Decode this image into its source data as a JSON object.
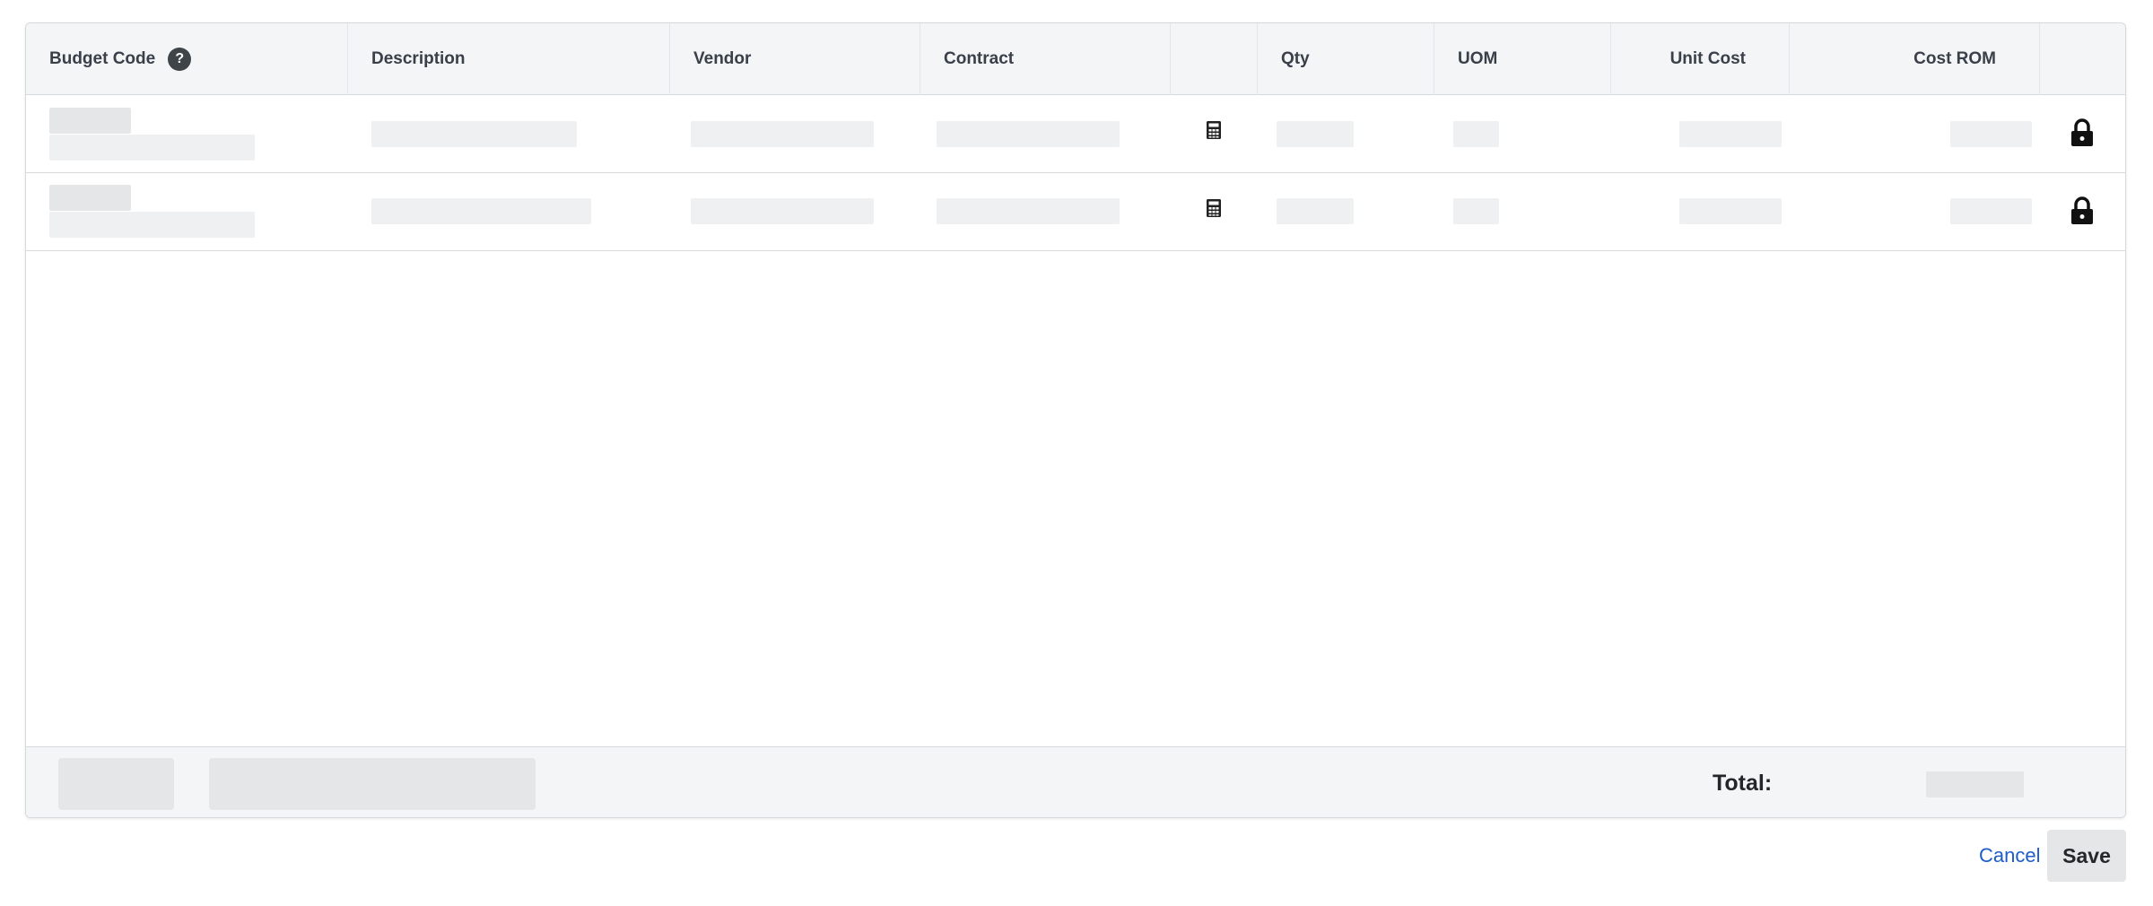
{
  "table": {
    "columns": {
      "budget_code": "Budget Code",
      "description": "Description",
      "vendor": "Vendor",
      "contract": "Contract",
      "calc": "",
      "qty": "Qty",
      "uom": "UOM",
      "unit_cost": "Unit Cost",
      "cost_rom": "Cost ROM",
      "lock": ""
    },
    "help_glyph": "?",
    "row_count": 2,
    "row_icons": [
      "calculator-icon",
      "lock-icon"
    ]
  },
  "footer": {
    "total_label": "Total:"
  },
  "actions": {
    "cancel_label": "Cancel",
    "save_label": "Save"
  },
  "colors": {
    "header_bg": "#f4f5f6",
    "skeleton": "#eef0f1",
    "link": "#1d5cc9",
    "border": "#d6dadc"
  }
}
